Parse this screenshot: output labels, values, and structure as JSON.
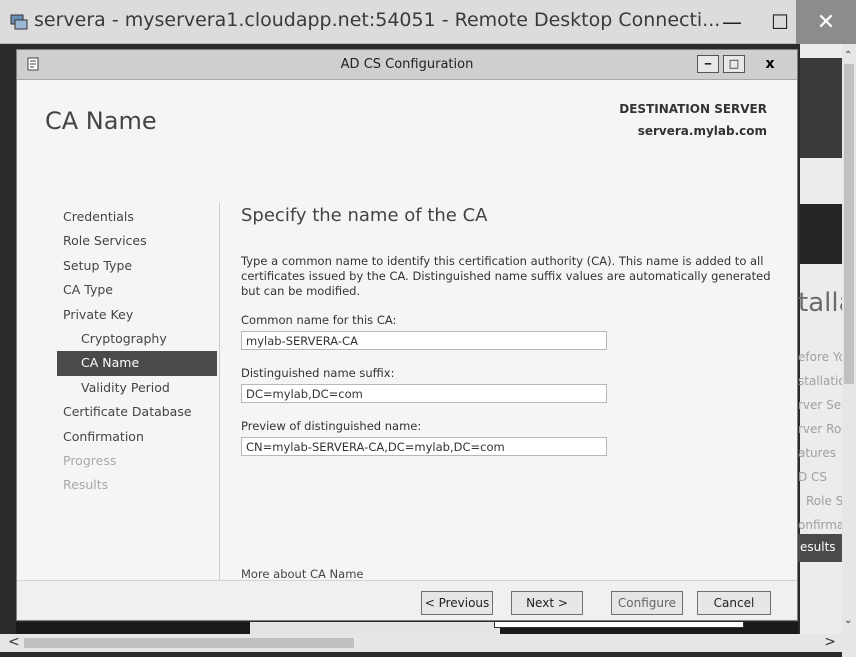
{
  "rdp": {
    "title": "servera - myservera1.cloudapp.net:54051 - Remote Desktop Connecti...",
    "minimize": "—",
    "maximize": "☐",
    "close": "✕"
  },
  "dialog": {
    "title": "AD CS Configuration",
    "minimize": "‒",
    "maximize": "□",
    "close": "x",
    "page_title": "CA Name",
    "destination_label": "DESTINATION SERVER",
    "destination_server": "servera.mylab.com"
  },
  "nav": {
    "items": [
      {
        "label": "Credentials"
      },
      {
        "label": "Role Services"
      },
      {
        "label": "Setup Type"
      },
      {
        "label": "CA Type"
      },
      {
        "label": "Private Key"
      },
      {
        "label": "Cryptography"
      },
      {
        "label": "CA Name"
      },
      {
        "label": "Validity Period"
      },
      {
        "label": "Certificate Database"
      },
      {
        "label": "Confirmation"
      },
      {
        "label": "Progress"
      },
      {
        "label": "Results"
      }
    ]
  },
  "main": {
    "heading": "Specify the name of the CA",
    "description": "Type a common name to identify this certification authority (CA). This name is added to all certificates issued by the CA. Distinguished name suffix values are automatically generated but can be modified.",
    "common_name_label": "Common name for this CA:",
    "common_name_value": "mylab-SERVERA-CA",
    "dn_suffix_label": "Distinguished name suffix:",
    "dn_suffix_value": "DC=mylab,DC=com",
    "preview_label": "Preview of distinguished name:",
    "preview_value": "CN=mylab-SERVERA-CA,DC=mylab,DC=com",
    "more_link": "More about CA Name"
  },
  "footer": {
    "previous": "< Previous",
    "next": "Next >",
    "configure": "Configure",
    "cancel": "Cancel"
  },
  "background": {
    "heading_fragment": "talla",
    "items": [
      "efore Yo",
      "stallatio",
      "rver Se",
      "rver Ro",
      "atures",
      "D CS",
      "Role S",
      "onfirma"
    ],
    "results": "esults"
  }
}
